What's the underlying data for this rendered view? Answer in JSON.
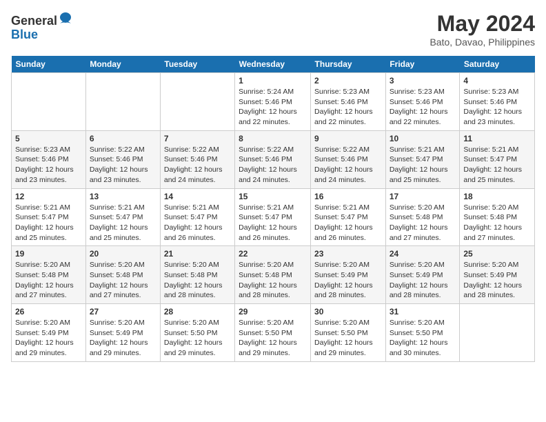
{
  "header": {
    "logo_line1": "General",
    "logo_line2": "Blue",
    "month_title": "May 2024",
    "location": "Bato, Davao, Philippines"
  },
  "days_of_week": [
    "Sunday",
    "Monday",
    "Tuesday",
    "Wednesday",
    "Thursday",
    "Friday",
    "Saturday"
  ],
  "weeks": [
    [
      {
        "num": "",
        "info": ""
      },
      {
        "num": "",
        "info": ""
      },
      {
        "num": "",
        "info": ""
      },
      {
        "num": "1",
        "info": "Sunrise: 5:24 AM\nSunset: 5:46 PM\nDaylight: 12 hours\nand 22 minutes."
      },
      {
        "num": "2",
        "info": "Sunrise: 5:23 AM\nSunset: 5:46 PM\nDaylight: 12 hours\nand 22 minutes."
      },
      {
        "num": "3",
        "info": "Sunrise: 5:23 AM\nSunset: 5:46 PM\nDaylight: 12 hours\nand 22 minutes."
      },
      {
        "num": "4",
        "info": "Sunrise: 5:23 AM\nSunset: 5:46 PM\nDaylight: 12 hours\nand 23 minutes."
      }
    ],
    [
      {
        "num": "5",
        "info": "Sunrise: 5:23 AM\nSunset: 5:46 PM\nDaylight: 12 hours\nand 23 minutes."
      },
      {
        "num": "6",
        "info": "Sunrise: 5:22 AM\nSunset: 5:46 PM\nDaylight: 12 hours\nand 23 minutes."
      },
      {
        "num": "7",
        "info": "Sunrise: 5:22 AM\nSunset: 5:46 PM\nDaylight: 12 hours\nand 24 minutes."
      },
      {
        "num": "8",
        "info": "Sunrise: 5:22 AM\nSunset: 5:46 PM\nDaylight: 12 hours\nand 24 minutes."
      },
      {
        "num": "9",
        "info": "Sunrise: 5:22 AM\nSunset: 5:46 PM\nDaylight: 12 hours\nand 24 minutes."
      },
      {
        "num": "10",
        "info": "Sunrise: 5:21 AM\nSunset: 5:47 PM\nDaylight: 12 hours\nand 25 minutes."
      },
      {
        "num": "11",
        "info": "Sunrise: 5:21 AM\nSunset: 5:47 PM\nDaylight: 12 hours\nand 25 minutes."
      }
    ],
    [
      {
        "num": "12",
        "info": "Sunrise: 5:21 AM\nSunset: 5:47 PM\nDaylight: 12 hours\nand 25 minutes."
      },
      {
        "num": "13",
        "info": "Sunrise: 5:21 AM\nSunset: 5:47 PM\nDaylight: 12 hours\nand 25 minutes."
      },
      {
        "num": "14",
        "info": "Sunrise: 5:21 AM\nSunset: 5:47 PM\nDaylight: 12 hours\nand 26 minutes."
      },
      {
        "num": "15",
        "info": "Sunrise: 5:21 AM\nSunset: 5:47 PM\nDaylight: 12 hours\nand 26 minutes."
      },
      {
        "num": "16",
        "info": "Sunrise: 5:21 AM\nSunset: 5:47 PM\nDaylight: 12 hours\nand 26 minutes."
      },
      {
        "num": "17",
        "info": "Sunrise: 5:20 AM\nSunset: 5:48 PM\nDaylight: 12 hours\nand 27 minutes."
      },
      {
        "num": "18",
        "info": "Sunrise: 5:20 AM\nSunset: 5:48 PM\nDaylight: 12 hours\nand 27 minutes."
      }
    ],
    [
      {
        "num": "19",
        "info": "Sunrise: 5:20 AM\nSunset: 5:48 PM\nDaylight: 12 hours\nand 27 minutes."
      },
      {
        "num": "20",
        "info": "Sunrise: 5:20 AM\nSunset: 5:48 PM\nDaylight: 12 hours\nand 27 minutes."
      },
      {
        "num": "21",
        "info": "Sunrise: 5:20 AM\nSunset: 5:48 PM\nDaylight: 12 hours\nand 28 minutes."
      },
      {
        "num": "22",
        "info": "Sunrise: 5:20 AM\nSunset: 5:48 PM\nDaylight: 12 hours\nand 28 minutes."
      },
      {
        "num": "23",
        "info": "Sunrise: 5:20 AM\nSunset: 5:49 PM\nDaylight: 12 hours\nand 28 minutes."
      },
      {
        "num": "24",
        "info": "Sunrise: 5:20 AM\nSunset: 5:49 PM\nDaylight: 12 hours\nand 28 minutes."
      },
      {
        "num": "25",
        "info": "Sunrise: 5:20 AM\nSunset: 5:49 PM\nDaylight: 12 hours\nand 28 minutes."
      }
    ],
    [
      {
        "num": "26",
        "info": "Sunrise: 5:20 AM\nSunset: 5:49 PM\nDaylight: 12 hours\nand 29 minutes."
      },
      {
        "num": "27",
        "info": "Sunrise: 5:20 AM\nSunset: 5:49 PM\nDaylight: 12 hours\nand 29 minutes."
      },
      {
        "num": "28",
        "info": "Sunrise: 5:20 AM\nSunset: 5:50 PM\nDaylight: 12 hours\nand 29 minutes."
      },
      {
        "num": "29",
        "info": "Sunrise: 5:20 AM\nSunset: 5:50 PM\nDaylight: 12 hours\nand 29 minutes."
      },
      {
        "num": "30",
        "info": "Sunrise: 5:20 AM\nSunset: 5:50 PM\nDaylight: 12 hours\nand 29 minutes."
      },
      {
        "num": "31",
        "info": "Sunrise: 5:20 AM\nSunset: 5:50 PM\nDaylight: 12 hours\nand 30 minutes."
      },
      {
        "num": "",
        "info": ""
      }
    ]
  ]
}
